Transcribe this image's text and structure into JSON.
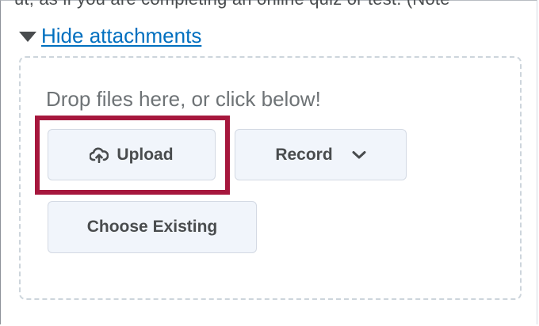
{
  "top_text": "ut, as if you are completing an online quiz or test. (Note",
  "attachments": {
    "toggle_label": "Hide attachments",
    "drop_prompt": "Drop files here, or click below!",
    "buttons": {
      "upload": {
        "label": "Upload",
        "icon": "cloud-upload-icon"
      },
      "record": {
        "label": "Record",
        "icon": "chevron-down-icon"
      },
      "choose_existing": {
        "label": "Choose Existing"
      }
    }
  },
  "colors": {
    "link": "#006fbf",
    "highlight": "#a6173d",
    "button_bg": "#f1f5fb",
    "text": "#494c4e"
  }
}
